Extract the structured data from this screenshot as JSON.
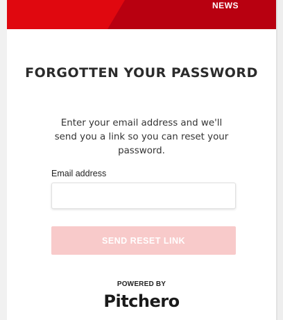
{
  "banner": {
    "nav_text": "NEWS"
  },
  "form": {
    "title": "FORGOTTEN YOUR PASSWORD",
    "intro": "Enter your email address and we'll send you a link so you can reset your password.",
    "email_label": "Email address",
    "email_value": "",
    "email_placeholder": "",
    "submit_label": "SEND RESET LINK"
  },
  "footer": {
    "powered_by": "POWERED BY",
    "brand": "Pitchero"
  },
  "colors": {
    "banner_red": "#e0080f",
    "banner_dark_red": "#b80010",
    "button_disabled": "#f8caca",
    "text_dark": "#2b2b2b"
  }
}
